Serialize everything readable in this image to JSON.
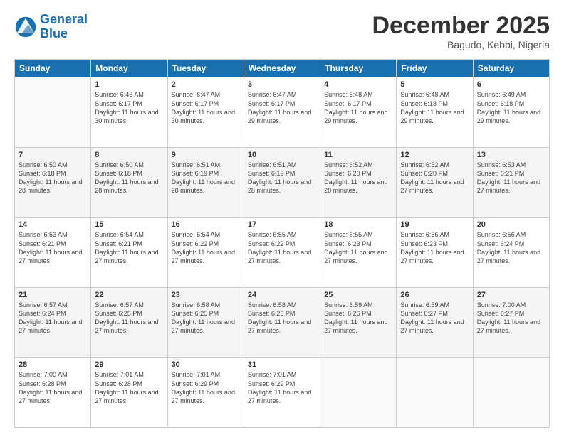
{
  "header": {
    "logo_general": "General",
    "logo_blue": "Blue",
    "month_title": "December 2025",
    "subtitle": "Bagudo, Kebbi, Nigeria"
  },
  "weekdays": [
    "Sunday",
    "Monday",
    "Tuesday",
    "Wednesday",
    "Thursday",
    "Friday",
    "Saturday"
  ],
  "weeks": [
    [
      {
        "day": "",
        "sunrise": "",
        "sunset": "",
        "daylight": ""
      },
      {
        "day": "1",
        "sunrise": "Sunrise: 6:46 AM",
        "sunset": "Sunset: 6:17 PM",
        "daylight": "Daylight: 11 hours and 30 minutes."
      },
      {
        "day": "2",
        "sunrise": "Sunrise: 6:47 AM",
        "sunset": "Sunset: 6:17 PM",
        "daylight": "Daylight: 11 hours and 30 minutes."
      },
      {
        "day": "3",
        "sunrise": "Sunrise: 6:47 AM",
        "sunset": "Sunset: 6:17 PM",
        "daylight": "Daylight: 11 hours and 29 minutes."
      },
      {
        "day": "4",
        "sunrise": "Sunrise: 6:48 AM",
        "sunset": "Sunset: 6:17 PM",
        "daylight": "Daylight: 11 hours and 29 minutes."
      },
      {
        "day": "5",
        "sunrise": "Sunrise: 6:48 AM",
        "sunset": "Sunset: 6:18 PM",
        "daylight": "Daylight: 11 hours and 29 minutes."
      },
      {
        "day": "6",
        "sunrise": "Sunrise: 6:49 AM",
        "sunset": "Sunset: 6:18 PM",
        "daylight": "Daylight: 11 hours and 29 minutes."
      }
    ],
    [
      {
        "day": "7",
        "sunrise": "Sunrise: 6:50 AM",
        "sunset": "Sunset: 6:18 PM",
        "daylight": "Daylight: 11 hours and 28 minutes."
      },
      {
        "day": "8",
        "sunrise": "Sunrise: 6:50 AM",
        "sunset": "Sunset: 6:18 PM",
        "daylight": "Daylight: 11 hours and 28 minutes."
      },
      {
        "day": "9",
        "sunrise": "Sunrise: 6:51 AM",
        "sunset": "Sunset: 6:19 PM",
        "daylight": "Daylight: 11 hours and 28 minutes."
      },
      {
        "day": "10",
        "sunrise": "Sunrise: 6:51 AM",
        "sunset": "Sunset: 6:19 PM",
        "daylight": "Daylight: 11 hours and 28 minutes."
      },
      {
        "day": "11",
        "sunrise": "Sunrise: 6:52 AM",
        "sunset": "Sunset: 6:20 PM",
        "daylight": "Daylight: 11 hours and 28 minutes."
      },
      {
        "day": "12",
        "sunrise": "Sunrise: 6:52 AM",
        "sunset": "Sunset: 6:20 PM",
        "daylight": "Daylight: 11 hours and 27 minutes."
      },
      {
        "day": "13",
        "sunrise": "Sunrise: 6:53 AM",
        "sunset": "Sunset: 6:21 PM",
        "daylight": "Daylight: 11 hours and 27 minutes."
      }
    ],
    [
      {
        "day": "14",
        "sunrise": "Sunrise: 6:53 AM",
        "sunset": "Sunset: 6:21 PM",
        "daylight": "Daylight: 11 hours and 27 minutes."
      },
      {
        "day": "15",
        "sunrise": "Sunrise: 6:54 AM",
        "sunset": "Sunset: 6:21 PM",
        "daylight": "Daylight: 11 hours and 27 minutes."
      },
      {
        "day": "16",
        "sunrise": "Sunrise: 6:54 AM",
        "sunset": "Sunset: 6:22 PM",
        "daylight": "Daylight: 11 hours and 27 minutes."
      },
      {
        "day": "17",
        "sunrise": "Sunrise: 6:55 AM",
        "sunset": "Sunset: 6:22 PM",
        "daylight": "Daylight: 11 hours and 27 minutes."
      },
      {
        "day": "18",
        "sunrise": "Sunrise: 6:55 AM",
        "sunset": "Sunset: 6:23 PM",
        "daylight": "Daylight: 11 hours and 27 minutes."
      },
      {
        "day": "19",
        "sunrise": "Sunrise: 6:56 AM",
        "sunset": "Sunset: 6:23 PM",
        "daylight": "Daylight: 11 hours and 27 minutes."
      },
      {
        "day": "20",
        "sunrise": "Sunrise: 6:56 AM",
        "sunset": "Sunset: 6:24 PM",
        "daylight": "Daylight: 11 hours and 27 minutes."
      }
    ],
    [
      {
        "day": "21",
        "sunrise": "Sunrise: 6:57 AM",
        "sunset": "Sunset: 6:24 PM",
        "daylight": "Daylight: 11 hours and 27 minutes."
      },
      {
        "day": "22",
        "sunrise": "Sunrise: 6:57 AM",
        "sunset": "Sunset: 6:25 PM",
        "daylight": "Daylight: 11 hours and 27 minutes."
      },
      {
        "day": "23",
        "sunrise": "Sunrise: 6:58 AM",
        "sunset": "Sunset: 6:25 PM",
        "daylight": "Daylight: 11 hours and 27 minutes."
      },
      {
        "day": "24",
        "sunrise": "Sunrise: 6:58 AM",
        "sunset": "Sunset: 6:26 PM",
        "daylight": "Daylight: 11 hours and 27 minutes."
      },
      {
        "day": "25",
        "sunrise": "Sunrise: 6:59 AM",
        "sunset": "Sunset: 6:26 PM",
        "daylight": "Daylight: 11 hours and 27 minutes."
      },
      {
        "day": "26",
        "sunrise": "Sunrise: 6:59 AM",
        "sunset": "Sunset: 6:27 PM",
        "daylight": "Daylight: 11 hours and 27 minutes."
      },
      {
        "day": "27",
        "sunrise": "Sunrise: 7:00 AM",
        "sunset": "Sunset: 6:27 PM",
        "daylight": "Daylight: 11 hours and 27 minutes."
      }
    ],
    [
      {
        "day": "28",
        "sunrise": "Sunrise: 7:00 AM",
        "sunset": "Sunset: 6:28 PM",
        "daylight": "Daylight: 11 hours and 27 minutes."
      },
      {
        "day": "29",
        "sunrise": "Sunrise: 7:01 AM",
        "sunset": "Sunset: 6:28 PM",
        "daylight": "Daylight: 11 hours and 27 minutes."
      },
      {
        "day": "30",
        "sunrise": "Sunrise: 7:01 AM",
        "sunset": "Sunset: 6:29 PM",
        "daylight": "Daylight: 11 hours and 27 minutes."
      },
      {
        "day": "31",
        "sunrise": "Sunrise: 7:01 AM",
        "sunset": "Sunset: 6:29 PM",
        "daylight": "Daylight: 11 hours and 27 minutes."
      },
      {
        "day": "",
        "sunrise": "",
        "sunset": "",
        "daylight": ""
      },
      {
        "day": "",
        "sunrise": "",
        "sunset": "",
        "daylight": ""
      },
      {
        "day": "",
        "sunrise": "",
        "sunset": "",
        "daylight": ""
      }
    ]
  ]
}
